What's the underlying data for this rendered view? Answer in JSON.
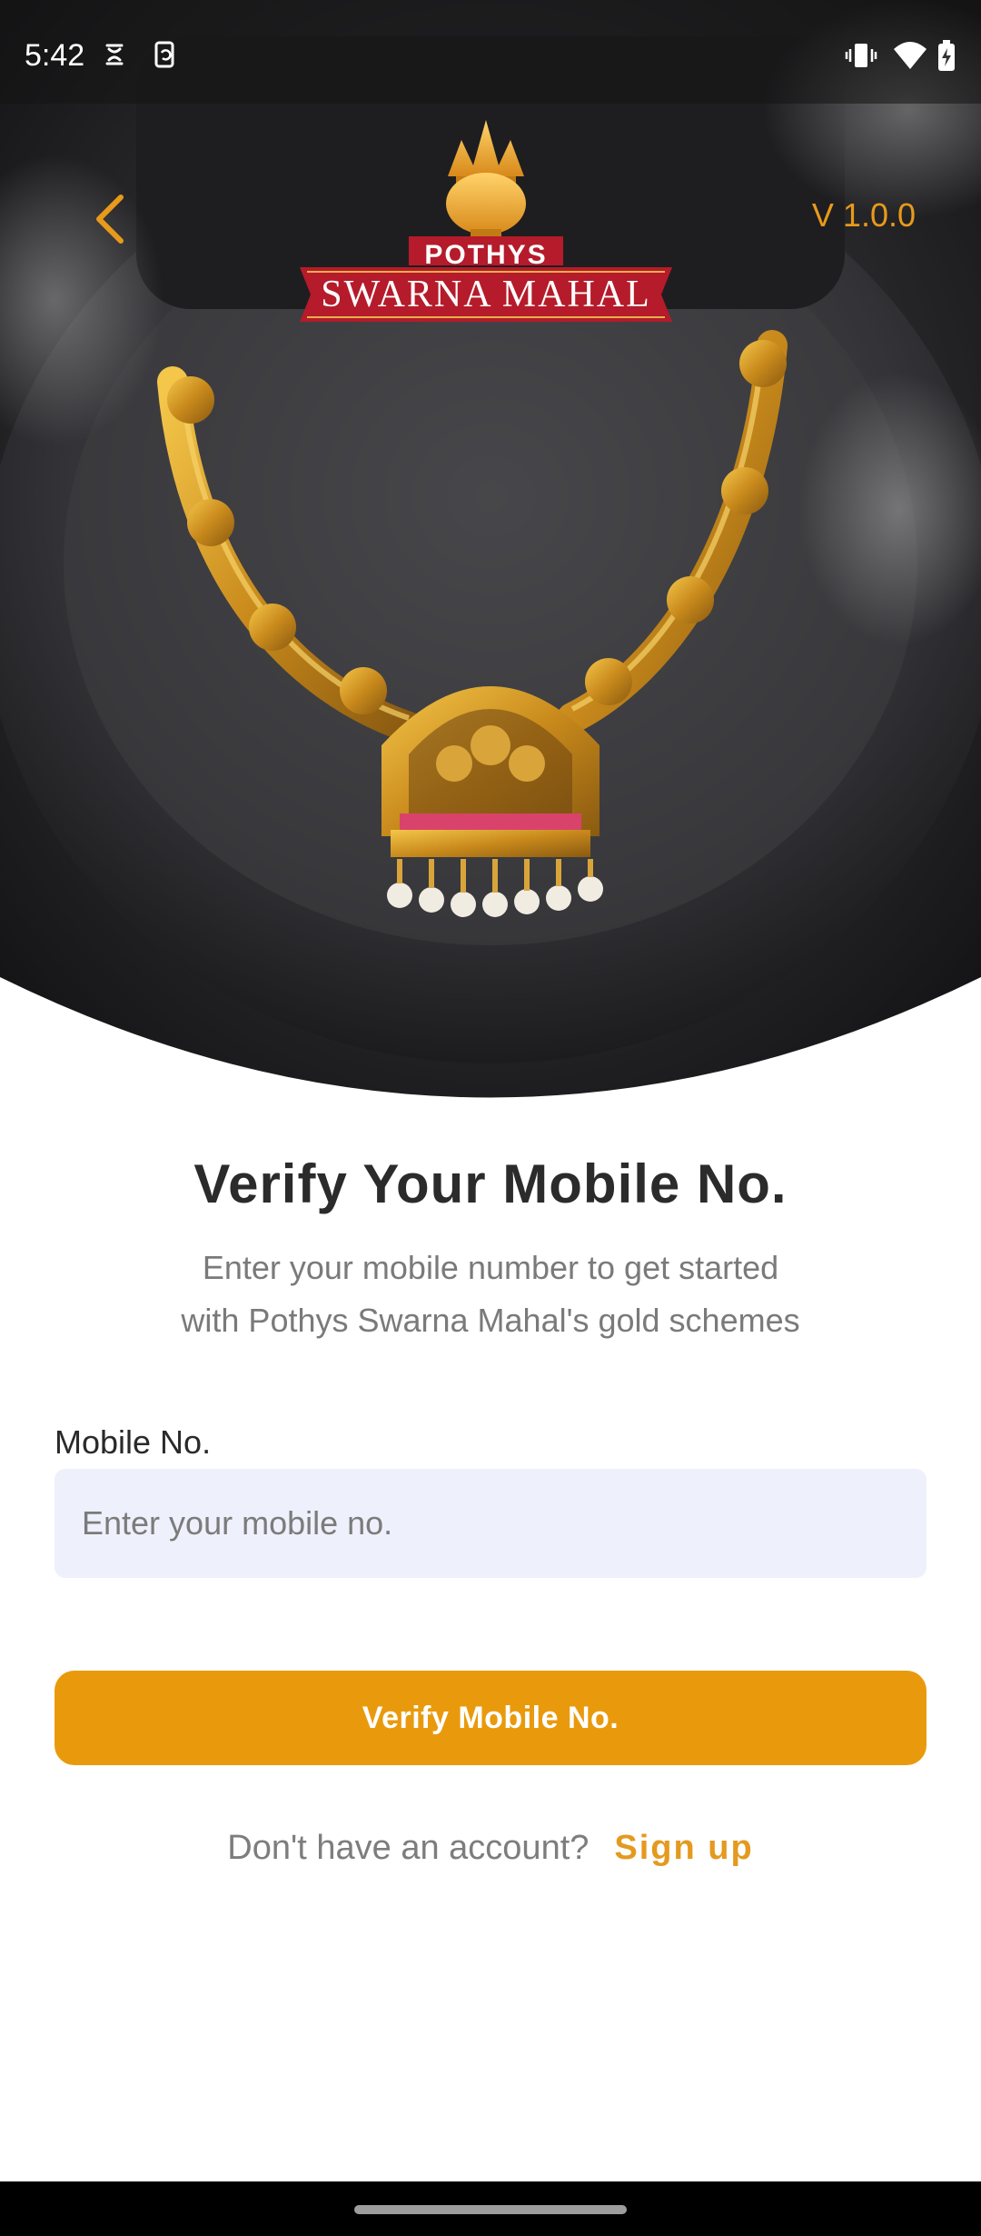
{
  "status_bar": {
    "time": "5:42",
    "left_icons": [
      "data-saver-icon",
      "screen-rotate-icon"
    ],
    "right_icons": [
      "vibrate-icon",
      "wifi-icon",
      "battery-charging-icon"
    ]
  },
  "header": {
    "back_icon": "chevron-left-icon",
    "version": "V 1.0.0"
  },
  "logo": {
    "brand_top": "POTHYS",
    "brand_main": "SWARNA MAHAL"
  },
  "hero": {
    "image": "gold-necklace-on-dark-stone"
  },
  "form": {
    "title": "Verify Your Mobile No.",
    "subtitle_line1": "Enter your mobile number to get started",
    "subtitle_line2": "with Pothys Swarna Mahal's gold schemes",
    "mobile_label": "Mobile No.",
    "mobile_value": "",
    "mobile_placeholder": "Enter your mobile no.",
    "verify_button": "Verify Mobile No.",
    "signup_prompt": "Don't have an account?",
    "signup_link": "Sign up"
  },
  "colors": {
    "accent": "#e99a0c",
    "input_bg": "#eef0fb",
    "title": "#2b2b2b",
    "muted": "#7a7a7a"
  }
}
